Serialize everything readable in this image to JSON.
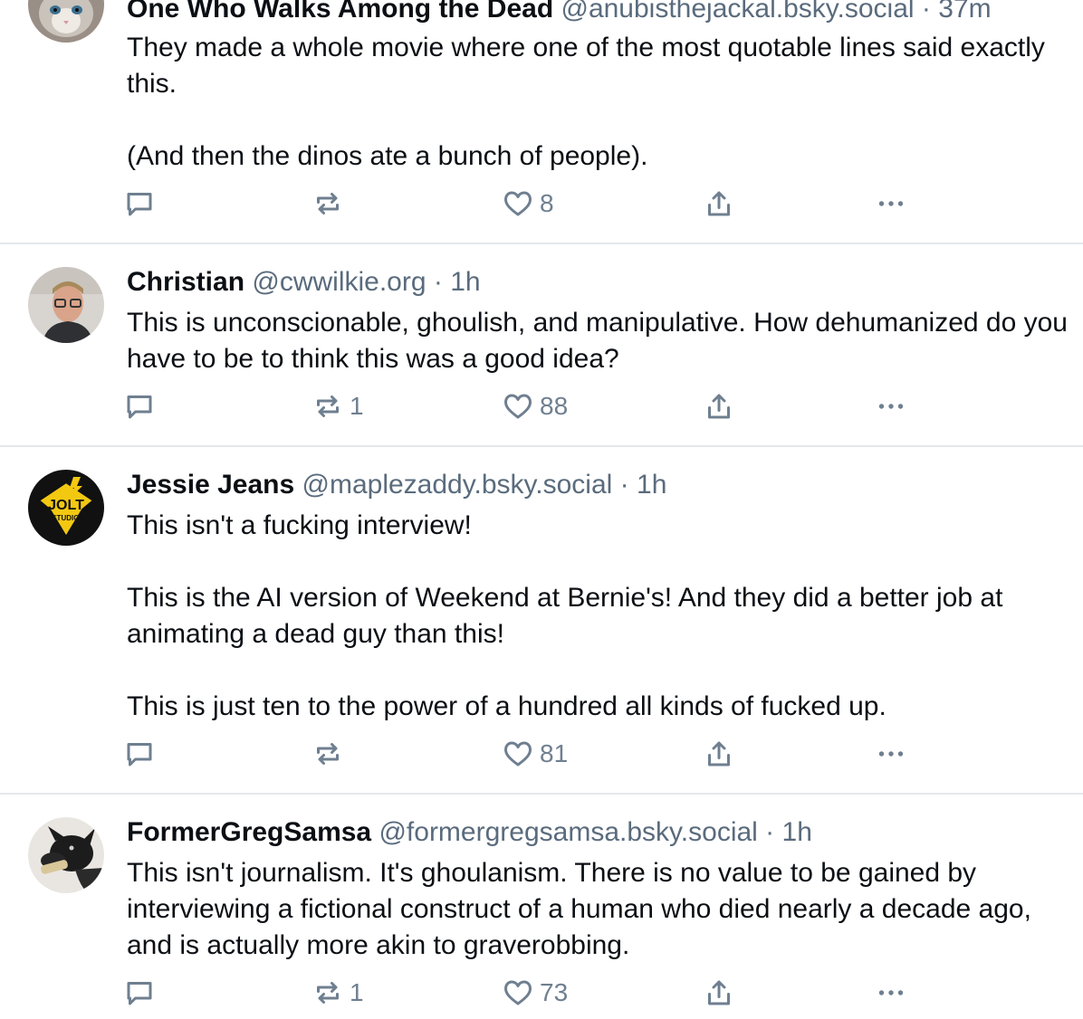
{
  "posts": [
    {
      "author_name": "One Who Walks Among the Dead",
      "handle": "@anubisthejackal.bsky.social",
      "separator": "·",
      "time": "37m",
      "text": "They made a whole movie where one of the most quotable lines said exactly this.\n\n(And then the dinos ate a bunch of people).",
      "reposts": "",
      "likes": "8"
    },
    {
      "author_name": "Christian",
      "handle": "@cwwilkie.org",
      "separator": "·",
      "time": "1h",
      "text": "This is unconscionable, ghoulish, and manipulative. How dehumanized do you have to be to think this was a good idea?",
      "reposts": "1",
      "likes": "88"
    },
    {
      "author_name": "Jessie Jeans",
      "handle": "@maplezaddy.bsky.social",
      "separator": "·",
      "time": "1h",
      "text": "This isn't a fucking interview!\n\nThis is the AI version of Weekend at Bernie's! And they did a better job at animating a dead guy than this!\n\nThis is just ten to the power of a hundred all kinds of fucked up.",
      "reposts": "",
      "likes": "81",
      "avatar_text": "JOLT",
      "avatar_subtext": "STUDIOS"
    },
    {
      "author_name": "FormerGregSamsa",
      "handle": "@formergregsamsa.bsky.social",
      "separator": "·",
      "time": "1h",
      "text": "This isn't journalism. It's ghoulanism. There is no value to be gained by interviewing a fictional construct of a human who died nearly a decade ago, and is actually more akin to graverobbing.",
      "reposts": "1",
      "likes": "73"
    }
  ],
  "icons": {
    "reply": "reply-icon",
    "repost": "repost-icon",
    "like": "heart-icon",
    "share": "share-icon",
    "more": "more-options-icon"
  },
  "colors": {
    "text": "#0b0f14",
    "muted": "#5a6b7d",
    "icon": "#6f7f90",
    "divider": "#e4e8ec"
  }
}
